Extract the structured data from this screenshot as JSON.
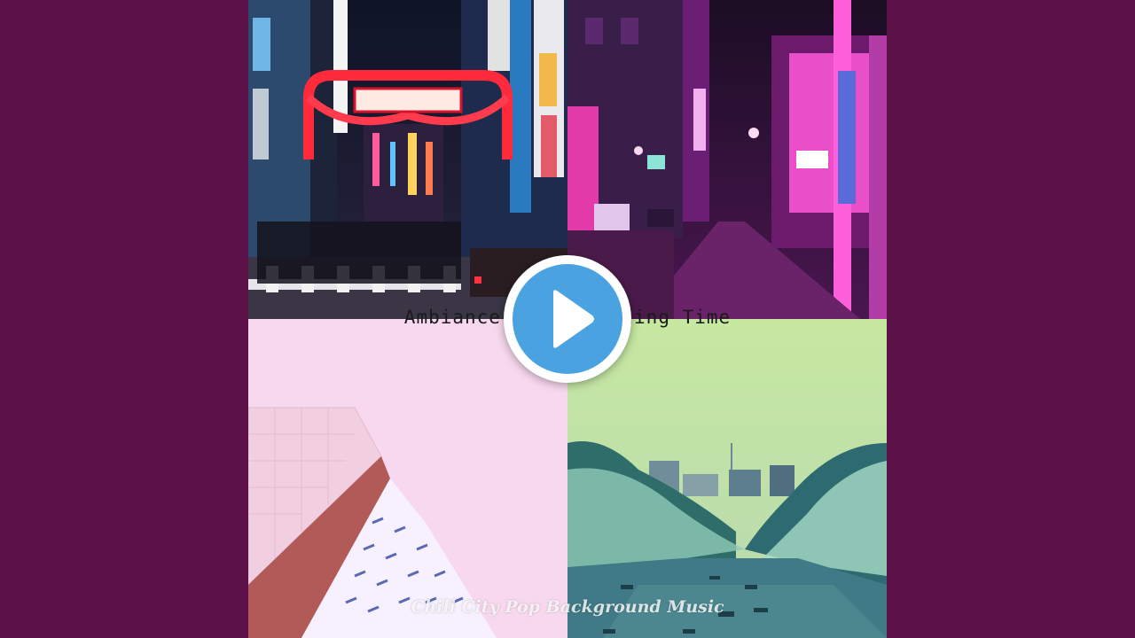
{
  "album": {
    "title_left": "Ambiance",
    "title_right": "ding Time",
    "subtitle": "Chill City Pop Background Music"
  },
  "overlay": {
    "play_icon": "play-icon"
  },
  "colors": {
    "background": "#5b1048",
    "play_fill": "#4aa3e0",
    "play_ring": "#ffffff"
  },
  "panels": [
    {
      "name": "tokyo-kabukicho-gate-photo"
    },
    {
      "name": "neon-alley-photo"
    },
    {
      "name": "skyscraper-sky-photo"
    },
    {
      "name": "park-pond-boats-photo"
    }
  ]
}
